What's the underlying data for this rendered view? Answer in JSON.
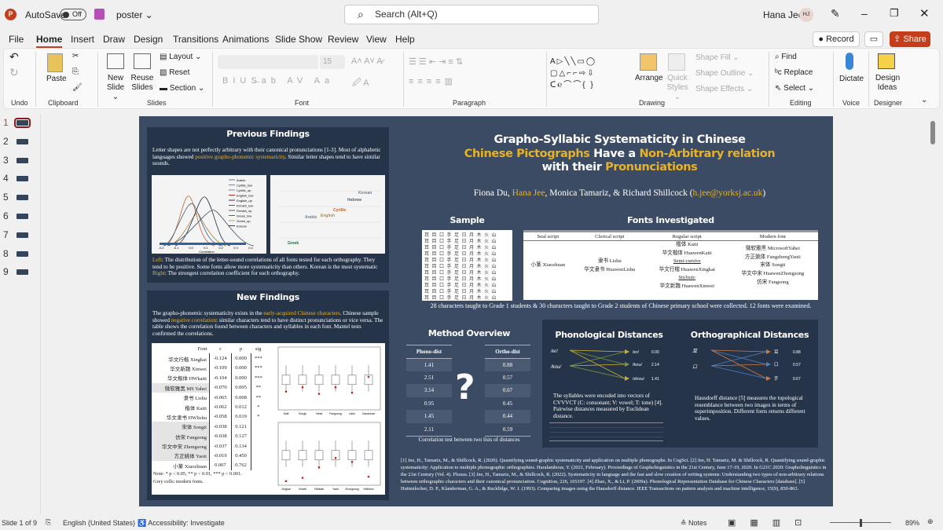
{
  "titlebar": {
    "app_letter": "P",
    "autosave": "AutoSave",
    "toggle": "Off",
    "filename": "poster ⌄",
    "search_placeholder": "Search (Alt+Q)",
    "user": "Hana Jee",
    "initials": "HJ"
  },
  "menu": [
    "File",
    "Home",
    "Insert",
    "Draw",
    "Design",
    "Transitions",
    "Animations",
    "Slide Show",
    "Review",
    "View",
    "Help"
  ],
  "actions": {
    "record": "Record",
    "share": "Share"
  },
  "ribbon": {
    "groups": [
      "Undo",
      "Clipboard",
      "Slides",
      "Font",
      "Paragraph",
      "Drawing",
      "Editing",
      "Voice",
      "Designer"
    ],
    "paste": "Paste",
    "new_slide": "New Slide ⌄",
    "reuse": "Reuse Slides",
    "layout": "Layout ⌄",
    "reset": "Reset",
    "section": "Section ⌄",
    "font_size": "15",
    "arrange": "Arrange",
    "quick_styles": "Quick Styles ⌄",
    "shape_fill": "Shape Fill ⌄",
    "shape_outline": "Shape Outline ⌄",
    "shape_effects": "Shape Effects ⌄",
    "find": "Find",
    "replace": "Replace",
    "select": "Select ⌄",
    "dictate": "Dictate",
    "design_ideas": "Design Ideas"
  },
  "thumbnails": [
    "1",
    "2",
    "3",
    "4",
    "5",
    "6",
    "7",
    "8",
    "9"
  ],
  "slide": {
    "title1": "Grapho-Syllabic Systematicity in Chinese",
    "title2a": "Chinese Pictographs",
    "title2b": " Have a ",
    "title2c": "Non-Arbitrary relation",
    "title3a": "with their ",
    "title3b": "Pronunciations",
    "authors": {
      "a1": "Fiona Du, ",
      "a2": "Hana Jee",
      "a3": ", Monica Tamariz, & Richard Shillcock (",
      "email": "h.jee@yorksj.ac.uk",
      "a4": ")"
    },
    "prev": {
      "heading": "Previous Findings",
      "t1": "Letter shapes are not perfectly arbitrary with their canonical pronunciations [1-3]. Most of alphabetic languages showed ",
      "t2": "positive grapho-phonemic systematicity",
      "t3": ". Similar letter shapes tend to have similar sounds.",
      "legend": [
        "Arabic",
        "Cyrillic_low",
        "Cyrillic_up",
        "English_low",
        "English_up",
        "Finnish_low",
        "Finnish_up",
        "Greek_low",
        "Greek_up",
        "Korean"
      ],
      "xticks": [
        "-0.2",
        "-0.1",
        "0.0",
        "0.1",
        "0.2",
        "0.3",
        "0.4"
      ],
      "xlabel": "Correlation",
      "right_labels": [
        "Korean",
        "Hebrew",
        "Cyrillic",
        "English",
        "Arabic",
        "Greek"
      ],
      "c1": "Left",
      "c2": ": The distribution of the letter-sound correlations of all fonts tested for each orthography. They tend to be positive. Some fonts allow more systematicity than others. Korean is the most systematic ",
      "c3": "Right",
      "c4": ": The strongest correlation coefficient for each orthography."
    },
    "newf": {
      "heading": "New Findings",
      "t1": "The grapho-phonemic systematicity exists in the ",
      "t2": "early-acquired Chinese characters",
      "t3": ".  Chinese sample showed ",
      "t4": "negative correlation",
      "t5": ": similar characters tend to have distinct pronunciations or vice versa. The table shows the correlation found between characters and syllables in each font.  Mantel tests confirmed the correlations.",
      "table_headers": [
        "Font",
        "r",
        "p",
        "sig"
      ],
      "rows": [
        {
          "font": "华文行楷 Xingkai",
          "r": "-0.124",
          "p": "0.000",
          "sig": "***",
          "grey": false
        },
        {
          "font": "华文新魏 Xinwei",
          "r": "-0.109",
          "p": "0.000",
          "sig": "***",
          "grey": false
        },
        {
          "font": "华文楷体 HWkaiti",
          "r": "-0.104",
          "p": "0.000",
          "sig": "***",
          "grey": false
        },
        {
          "font": "微软雅黑 MS Yahei",
          "r": "-0.070",
          "p": "0.005",
          "sig": "**",
          "grey": true
        },
        {
          "font": "隶书 Lishu",
          "r": "-0.065",
          "p": "0.008",
          "sig": "**",
          "grey": false
        },
        {
          "font": "楷体 Kaiti",
          "r": "-0.062",
          "p": "0.012",
          "sig": "*",
          "grey": false
        },
        {
          "font": "华文隶书 HWlishu",
          "r": "-0.058",
          "p": "0.019",
          "sig": "*",
          "grey": false
        },
        {
          "font": "宋体 Songti",
          "r": "-0.038",
          "p": "0.121",
          "sig": "",
          "grey": true
        },
        {
          "font": "仿宋 Fangsong",
          "r": "-0.038",
          "p": "0.127",
          "sig": "",
          "grey": true
        },
        {
          "font": "华文中宋 Zhongsong",
          "r": "-0.037",
          "p": "0.134",
          "sig": "",
          "grey": true
        },
        {
          "font": "方正姚体 Yaoti",
          "r": "-0.019",
          "p": "0.450",
          "sig": "",
          "grey": true
        },
        {
          "font": "小篆 Xiaozhuan",
          "r": "0.007",
          "p": "0.762",
          "sig": "",
          "grey": false
        }
      ],
      "note": "Note: * p < 0.05, ** p < 0.01, *** p < 0.001.",
      "note2": "Grey cells: modern fonts.",
      "box1_labels": [
        "Kaiti",
        "Songti",
        "Yahei",
        "Fangsong",
        "Lishu",
        "Xiaozhuan"
      ],
      "box2_labels": [
        "Xingkai",
        "Xinwei",
        "HWkaiti",
        "Yaoti",
        "Zhongsong",
        "HWlishu"
      ]
    },
    "sample": {
      "heading": "Sample"
    },
    "fonts": {
      "heading": "Fonts Investigated",
      "headers": [
        "Seal script",
        "Clerical script",
        "Regular script",
        "Modern font"
      ],
      "seal": [
        "小篆 Xiaozhuan"
      ],
      "clerical": [
        "隶书 Lishu",
        "华文隶书 HuawenLishu"
      ],
      "regular": [
        "楷体 Kaiti",
        "华文楷体 HuawenKaiti",
        "Semi-cursive",
        "华文行楷 HuawenXingkai",
        "Stylistic",
        "华文新魏 HuawenXinwei"
      ],
      "modern": [
        "微软雅黑 MicrosoftYahei",
        "方正姚体 FangzhengYaoti",
        "宋体 Songti",
        "华文中宋 HuawenZhongsong",
        "仿宋 Fangsong"
      ],
      "caption": "28 characters taught to Grade 1 students & 30 characters taught to Grade 2 students of Chinese primary school were collected. 12 fonts were examined."
    },
    "method": {
      "heading": "Method Overview",
      "phono_header": "Phono-dist",
      "ortho_header": "Ortho-dist",
      "phono": [
        "1.41",
        "2.51",
        "3.14",
        "0.95",
        "1.45",
        "2.11"
      ],
      "ortho": [
        "0.88",
        "0.57",
        "0.67",
        "0.45",
        "0.44",
        "0.59"
      ],
      "mark": "?",
      "caption": "Correlation test between two lists of distances"
    },
    "phon": {
      "heading": "Phonological Distances",
      "left": [
        "/er/",
        "/kou/"
      ],
      "right": [
        {
          "s": "/er/",
          "v": "0.00"
        },
        {
          "s": "/kou/",
          "v": "2.14"
        },
        {
          "s": "/shou/",
          "v": "1.41"
        }
      ],
      "text": "The syllables were encoded into vectors of CVVVCT (C: consonant; V: vowel; T: tone) [4]. Pairwise distances measured by Euclidean distance."
    },
    "orth": {
      "heading": "Orthographical Distances",
      "left": [
        "耳",
        "口"
      ],
      "right": [
        {
          "s": "耳",
          "v": "0.88"
        },
        {
          "s": "口",
          "v": "0.57"
        },
        {
          "s": "手",
          "v": "0.67"
        }
      ],
      "text": "Hausdorff distance [5] measures the topological resemblance between two images in terms of superimposition. Different fonts returns different values."
    },
    "refs": "[1] Jee, H., Tamariz, M., & Shillcock, R. (2020). Quantifying sound-graphic systematicity and application on multiple phonographs. In CogSci. [2] Jee, H. Tamariz, M. & Shillcock, R. Quantifying sound-graphic systematicity: Application to multiple phonographic orthographies. Haralambous, Y. (2021, February). Proceedings of Grapholinguistics in the 21st Century, June 17-19, 2020. In G21C 2020: Grapholinguistics in the 21st Century (Vol. 4). Fluxus. [3] Jee, H., Tamariz, M., & Shillcock, R. (2022). Systematicity in language and the fast and slow creation of writing systems: Understanding two types of non-arbitrary relations between orthographic characters and their canonical pronunciation. Cognition, 226, 105197. [4] Zhao, X., & Li, P. (2009a). Phonological Representation Database for Chinese Characters [database]. [5] Huttenlocher, D. P., Klanderman, G. A., & Rucklidge, W. J. (1993). Comparing images using the Hausdorff distance. IEEE Transactions on pattern analysis and machine intelligence, 15(9), 850-863."
  },
  "status": {
    "slide": "Slide 1 of 9",
    "lang": "English (United States)",
    "access": "Accessibility: Investigate",
    "notes": "Notes",
    "zoom": "89%",
    "zoom_level": 89
  },
  "colors": {
    "accent": "#c43e1c",
    "slide_bg": "#3b4b64",
    "panel": "#26344a",
    "highlight": "#e8b226"
  }
}
